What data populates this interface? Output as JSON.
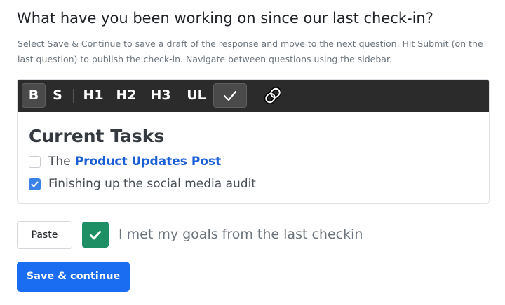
{
  "question": {
    "title": "What have you been working on since our last check-in?",
    "help_text": "Select Save & Continue to save a draft of the response and move to the next question. Hit Submit (on the last question) to publish the check-in. Navigate between questions using the sidebar."
  },
  "toolbar": {
    "bold": "B",
    "strike": "S",
    "h1": "H1",
    "h2": "H2",
    "h3": "H3",
    "ul": "UL",
    "active_items": [
      "bold",
      "checklist"
    ]
  },
  "editor": {
    "heading": "Current Tasks",
    "tasks": [
      {
        "checked": false,
        "text": "The",
        "link": "Product Updates Post"
      },
      {
        "checked": true,
        "text": "Finishing up the social media audit"
      }
    ]
  },
  "actions": {
    "paste_label": "Paste",
    "goals_checked": true,
    "goals_label": "I met my goals from the last checkin",
    "save_label": "Save & continue"
  },
  "colors": {
    "toolbar_bg": "#2b2b2b",
    "link": "#1a5fd6",
    "checkbox_checked": "#3b82e6",
    "goal_check": "#1e8f65",
    "primary_button": "#1a6cf0"
  }
}
